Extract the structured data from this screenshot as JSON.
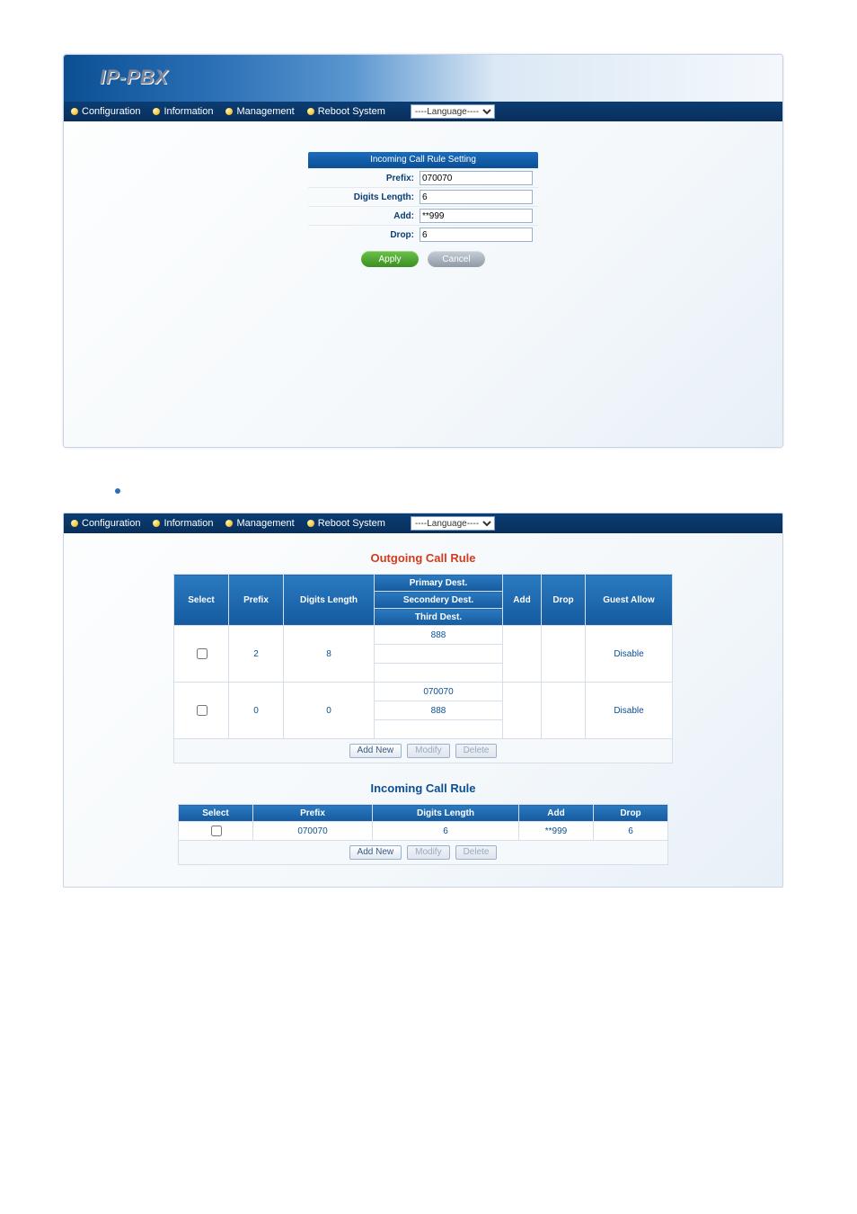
{
  "banner": {
    "title": "IP-PBX"
  },
  "nav": {
    "items": [
      "Configuration",
      "Information",
      "Management",
      "Reboot System"
    ],
    "language_placeholder": "----Language----"
  },
  "form": {
    "header": "Incoming Call Rule Setting",
    "labels": {
      "prefix": "Prefix:",
      "dlen": "Digits Length:",
      "add": "Add:",
      "drop": "Drop:"
    },
    "values": {
      "prefix": "070070",
      "dlen": "6",
      "add": "**999",
      "drop": "6"
    },
    "buttons": {
      "apply": "Apply",
      "cancel": "Cancel"
    }
  },
  "outgoing": {
    "title": "Outgoing Call Rule",
    "headers": {
      "select": "Select",
      "prefix": "Prefix",
      "dlen": "Digits Length",
      "dest1": "Primary Dest.",
      "dest2": "Secondery Dest.",
      "dest3": "Third Dest.",
      "add": "Add",
      "drop": "Drop",
      "guest": "Guest Allow"
    },
    "rows": [
      {
        "prefix": "2",
        "dlen": "8",
        "dest": [
          "888",
          "",
          ""
        ],
        "add": "",
        "drop": "",
        "guest": "Disable"
      },
      {
        "prefix": "0",
        "dlen": "0",
        "dest": [
          "070070",
          "888",
          ""
        ],
        "add": "",
        "drop": "",
        "guest": "Disable"
      }
    ],
    "buttons": {
      "addnew": "Add New",
      "modify": "Modify",
      "delete": "Delete"
    }
  },
  "incoming": {
    "title": "Incoming Call Rule",
    "headers": {
      "select": "Select",
      "prefix": "Prefix",
      "dlen": "Digits Length",
      "add": "Add",
      "drop": "Drop"
    },
    "rows": [
      {
        "prefix": "070070",
        "dlen": "6",
        "add": "**999",
        "drop": "6"
      }
    ],
    "buttons": {
      "addnew": "Add New",
      "modify": "Modify",
      "delete": "Delete"
    }
  }
}
